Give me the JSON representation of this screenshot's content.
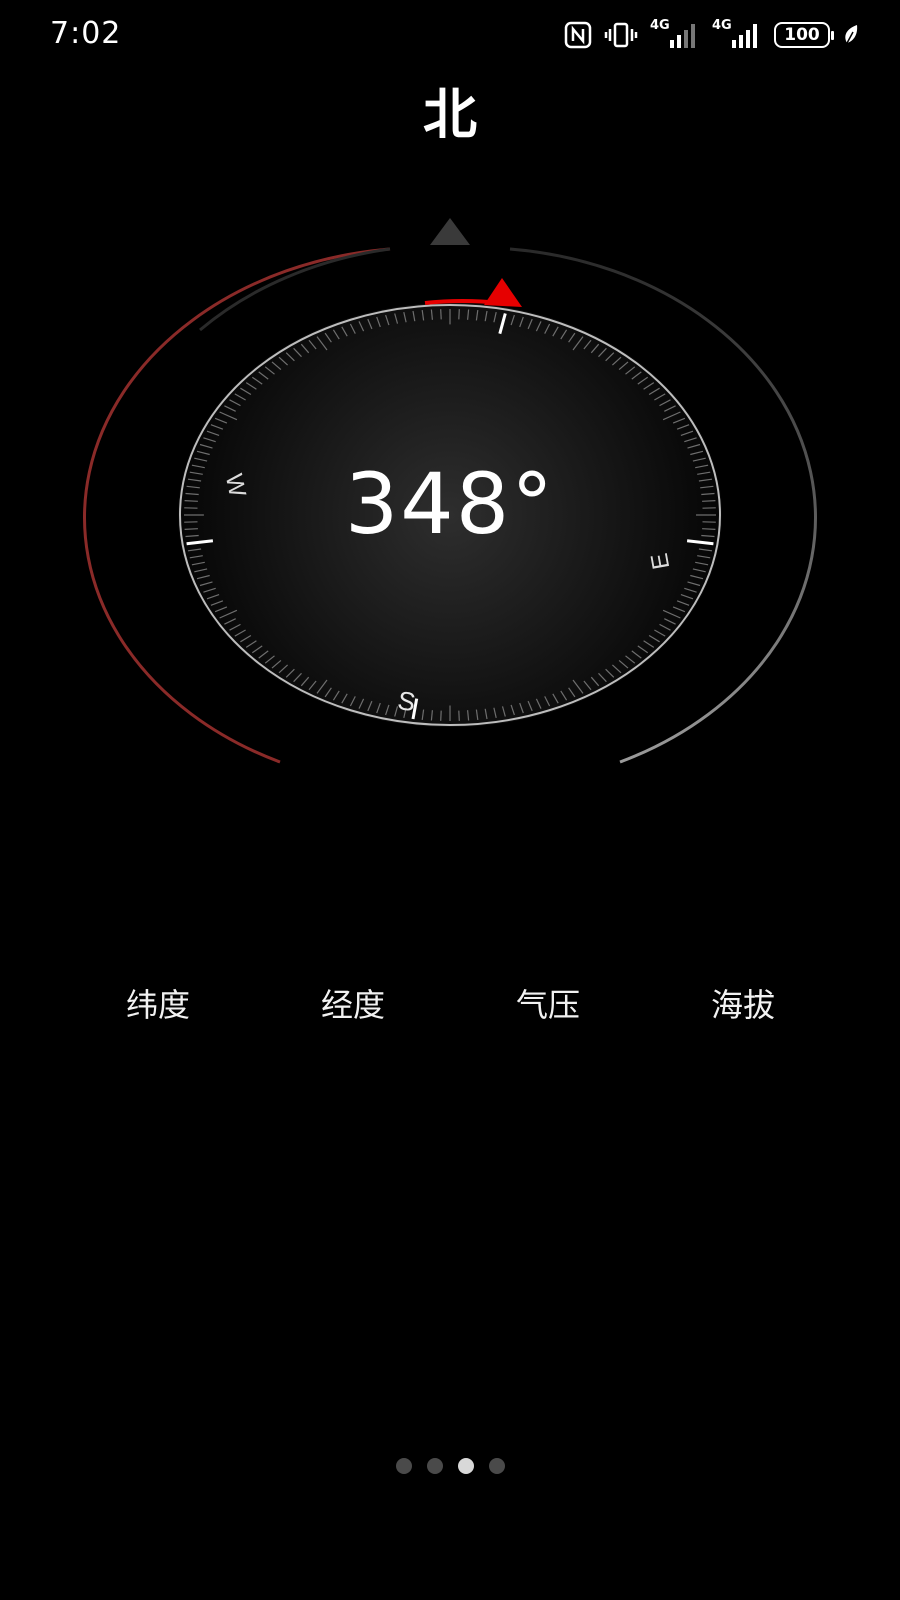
{
  "status_bar": {
    "time": "7:02",
    "icons": [
      "nfc-icon",
      "vibrate-icon",
      "signal-4g-icon",
      "signal-4g-icon",
      "battery-icon",
      "leaf-icon"
    ],
    "network_label_1": "4G",
    "network_label_2": "4G",
    "battery_level": "100"
  },
  "compass": {
    "direction": "北",
    "heading": "348°",
    "cardinals": {
      "west": "W",
      "east": "E",
      "south": "S"
    },
    "pointer_color": "#e60000",
    "accent_red": "#b8312f"
  },
  "info": {
    "items": [
      {
        "label": "纬度"
      },
      {
        "label": "经度"
      },
      {
        "label": "气压"
      },
      {
        "label": "海拔"
      }
    ]
  },
  "pager": {
    "total": 4,
    "active_index": 2
  }
}
